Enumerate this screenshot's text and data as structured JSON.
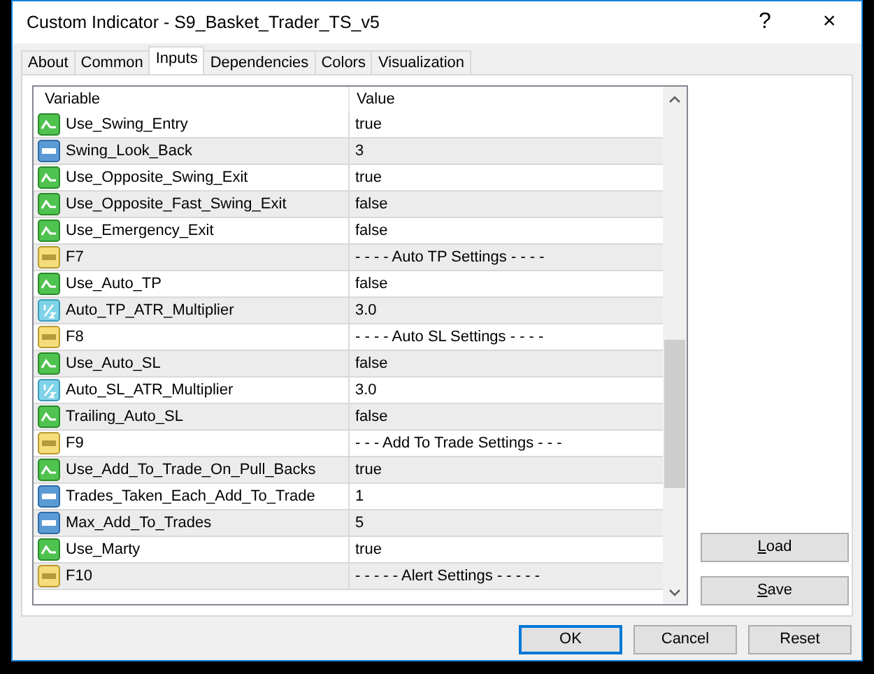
{
  "window": {
    "title": "Custom Indicator - S9_Basket_Trader_TS_v5",
    "help": "?",
    "close": "×"
  },
  "tabs": [
    {
      "label": "About",
      "selected": false
    },
    {
      "label": "Common",
      "selected": false
    },
    {
      "label": "Inputs",
      "selected": true
    },
    {
      "label": "Dependencies",
      "selected": false
    },
    {
      "label": "Colors",
      "selected": false
    },
    {
      "label": "Visualization",
      "selected": false
    }
  ],
  "table": {
    "columns": [
      "Variable",
      "Value"
    ],
    "rows": [
      {
        "kind": "bool",
        "variable": "Use_Swing_Entry",
        "value": "true"
      },
      {
        "kind": "int",
        "variable": "Swing_Look_Back",
        "value": "3"
      },
      {
        "kind": "bool",
        "variable": "Use_Opposite_Swing_Exit",
        "value": "true"
      },
      {
        "kind": "bool",
        "variable": "Use_Opposite_Fast_Swing_Exit",
        "value": "false"
      },
      {
        "kind": "bool",
        "variable": "Use_Emergency_Exit",
        "value": "false"
      },
      {
        "kind": "string",
        "variable": "F7",
        "value": "- - - - Auto TP Settings - - - -"
      },
      {
        "kind": "bool",
        "variable": "Use_Auto_TP",
        "value": "false"
      },
      {
        "kind": "double",
        "variable": "Auto_TP_ATR_Multiplier",
        "value": "3.0"
      },
      {
        "kind": "string",
        "variable": "F8",
        "value": "- - - - Auto SL Settings - - - -"
      },
      {
        "kind": "bool",
        "variable": "Use_Auto_SL",
        "value": "false"
      },
      {
        "kind": "double",
        "variable": "Auto_SL_ATR_Multiplier",
        "value": "3.0"
      },
      {
        "kind": "bool",
        "variable": "Trailing_Auto_SL",
        "value": "false"
      },
      {
        "kind": "string",
        "variable": "F9",
        "value": "- - - Add To Trade Settings - - -"
      },
      {
        "kind": "bool",
        "variable": "Use_Add_To_Trade_On_Pull_Backs",
        "value": "true"
      },
      {
        "kind": "int",
        "variable": "Trades_Taken_Each_Add_To_Trade",
        "value": "1"
      },
      {
        "kind": "int",
        "variable": "Max_Add_To_Trades",
        "value": "5"
      },
      {
        "kind": "bool",
        "variable": "Use_Marty",
        "value": "true"
      },
      {
        "kind": "string",
        "variable": "F10",
        "value": "- - - - - Alert Settings - - - - -"
      }
    ]
  },
  "side_buttons": [
    {
      "label": "Load",
      "underline_first": true
    },
    {
      "label": "Save",
      "underline_first": true
    }
  ],
  "buttons": [
    {
      "label": "OK",
      "default": true
    },
    {
      "label": "Cancel",
      "default": false
    },
    {
      "label": "Reset",
      "default": false
    }
  ]
}
